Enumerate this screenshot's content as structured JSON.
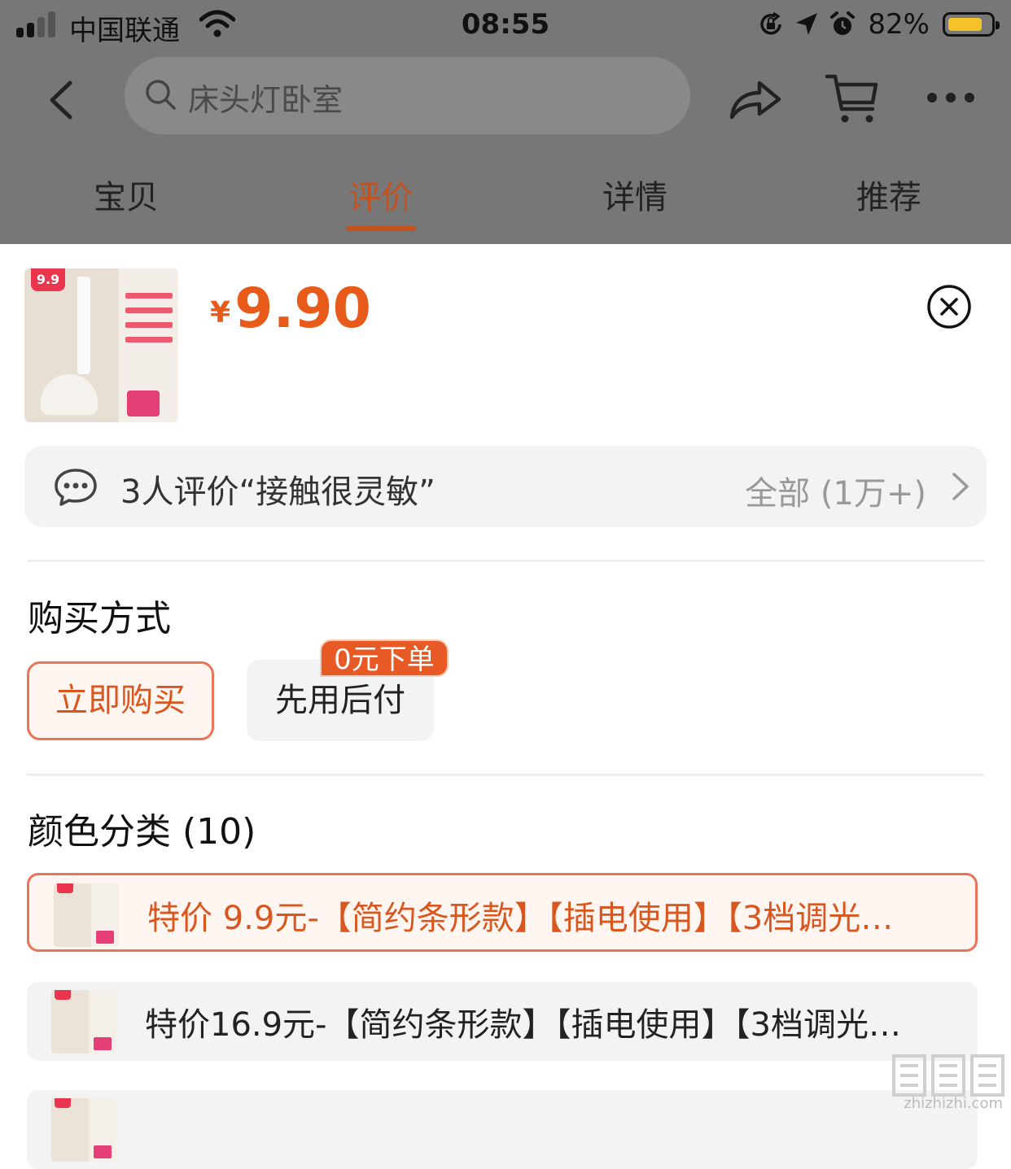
{
  "status_bar": {
    "carrier": "中国联通",
    "time": "08:55",
    "battery": "82%",
    "battery_level": 0.82
  },
  "nav": {
    "search_placeholder": "床头灯卧室"
  },
  "tabs": [
    {
      "label": "宝贝",
      "active": false
    },
    {
      "label": "评价",
      "active": true
    },
    {
      "label": "详情",
      "active": false
    },
    {
      "label": "推荐",
      "active": false
    }
  ],
  "product": {
    "image_tag": "9.9",
    "price_symbol": "¥",
    "price": "9.90"
  },
  "review_summary": {
    "text": "3人评价“接触很灵敏”",
    "all_label": "全部 (1万+)"
  },
  "purchase": {
    "title": "购买方式",
    "options": [
      {
        "label": "立即购买",
        "selected": true
      },
      {
        "label": "先用后付",
        "badge": "0元下单",
        "selected": false
      }
    ]
  },
  "colors": {
    "title": "颜色分类 (10)",
    "items": [
      {
        "label": "特价 9.9元-【简约条形款】【插电使用】【3档调光…",
        "selected": true
      },
      {
        "label": "特价16.9元-【简约条形款】【插电使用】【3档调光…",
        "selected": false
      }
    ]
  },
  "watermark": {
    "text": "zhizhizhi.com"
  },
  "accent": {
    "orange": "#e85a19",
    "tab_active": "#c5511c",
    "border": "#e8745a"
  }
}
